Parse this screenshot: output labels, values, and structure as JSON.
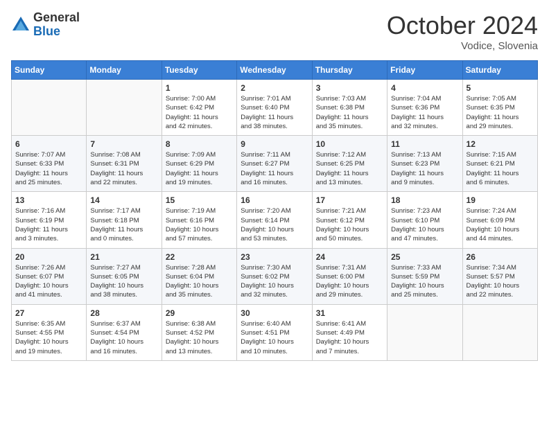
{
  "logo": {
    "line1": "General",
    "line2": "Blue"
  },
  "title": "October 2024",
  "subtitle": "Vodice, Slovenia",
  "weekdays": [
    "Sunday",
    "Monday",
    "Tuesday",
    "Wednesday",
    "Thursday",
    "Friday",
    "Saturday"
  ],
  "weeks": [
    [
      {
        "day": "",
        "content": ""
      },
      {
        "day": "",
        "content": ""
      },
      {
        "day": "1",
        "content": "Sunrise: 7:00 AM\nSunset: 6:42 PM\nDaylight: 11 hours\nand 42 minutes."
      },
      {
        "day": "2",
        "content": "Sunrise: 7:01 AM\nSunset: 6:40 PM\nDaylight: 11 hours\nand 38 minutes."
      },
      {
        "day": "3",
        "content": "Sunrise: 7:03 AM\nSunset: 6:38 PM\nDaylight: 11 hours\nand 35 minutes."
      },
      {
        "day": "4",
        "content": "Sunrise: 7:04 AM\nSunset: 6:36 PM\nDaylight: 11 hours\nand 32 minutes."
      },
      {
        "day": "5",
        "content": "Sunrise: 7:05 AM\nSunset: 6:35 PM\nDaylight: 11 hours\nand 29 minutes."
      }
    ],
    [
      {
        "day": "6",
        "content": "Sunrise: 7:07 AM\nSunset: 6:33 PM\nDaylight: 11 hours\nand 25 minutes."
      },
      {
        "day": "7",
        "content": "Sunrise: 7:08 AM\nSunset: 6:31 PM\nDaylight: 11 hours\nand 22 minutes."
      },
      {
        "day": "8",
        "content": "Sunrise: 7:09 AM\nSunset: 6:29 PM\nDaylight: 11 hours\nand 19 minutes."
      },
      {
        "day": "9",
        "content": "Sunrise: 7:11 AM\nSunset: 6:27 PM\nDaylight: 11 hours\nand 16 minutes."
      },
      {
        "day": "10",
        "content": "Sunrise: 7:12 AM\nSunset: 6:25 PM\nDaylight: 11 hours\nand 13 minutes."
      },
      {
        "day": "11",
        "content": "Sunrise: 7:13 AM\nSunset: 6:23 PM\nDaylight: 11 hours\nand 9 minutes."
      },
      {
        "day": "12",
        "content": "Sunrise: 7:15 AM\nSunset: 6:21 PM\nDaylight: 11 hours\nand 6 minutes."
      }
    ],
    [
      {
        "day": "13",
        "content": "Sunrise: 7:16 AM\nSunset: 6:19 PM\nDaylight: 11 hours\nand 3 minutes."
      },
      {
        "day": "14",
        "content": "Sunrise: 7:17 AM\nSunset: 6:18 PM\nDaylight: 11 hours\nand 0 minutes."
      },
      {
        "day": "15",
        "content": "Sunrise: 7:19 AM\nSunset: 6:16 PM\nDaylight: 10 hours\nand 57 minutes."
      },
      {
        "day": "16",
        "content": "Sunrise: 7:20 AM\nSunset: 6:14 PM\nDaylight: 10 hours\nand 53 minutes."
      },
      {
        "day": "17",
        "content": "Sunrise: 7:21 AM\nSunset: 6:12 PM\nDaylight: 10 hours\nand 50 minutes."
      },
      {
        "day": "18",
        "content": "Sunrise: 7:23 AM\nSunset: 6:10 PM\nDaylight: 10 hours\nand 47 minutes."
      },
      {
        "day": "19",
        "content": "Sunrise: 7:24 AM\nSunset: 6:09 PM\nDaylight: 10 hours\nand 44 minutes."
      }
    ],
    [
      {
        "day": "20",
        "content": "Sunrise: 7:26 AM\nSunset: 6:07 PM\nDaylight: 10 hours\nand 41 minutes."
      },
      {
        "day": "21",
        "content": "Sunrise: 7:27 AM\nSunset: 6:05 PM\nDaylight: 10 hours\nand 38 minutes."
      },
      {
        "day": "22",
        "content": "Sunrise: 7:28 AM\nSunset: 6:04 PM\nDaylight: 10 hours\nand 35 minutes."
      },
      {
        "day": "23",
        "content": "Sunrise: 7:30 AM\nSunset: 6:02 PM\nDaylight: 10 hours\nand 32 minutes."
      },
      {
        "day": "24",
        "content": "Sunrise: 7:31 AM\nSunset: 6:00 PM\nDaylight: 10 hours\nand 29 minutes."
      },
      {
        "day": "25",
        "content": "Sunrise: 7:33 AM\nSunset: 5:59 PM\nDaylight: 10 hours\nand 25 minutes."
      },
      {
        "day": "26",
        "content": "Sunrise: 7:34 AM\nSunset: 5:57 PM\nDaylight: 10 hours\nand 22 minutes."
      }
    ],
    [
      {
        "day": "27",
        "content": "Sunrise: 6:35 AM\nSunset: 4:55 PM\nDaylight: 10 hours\nand 19 minutes."
      },
      {
        "day": "28",
        "content": "Sunrise: 6:37 AM\nSunset: 4:54 PM\nDaylight: 10 hours\nand 16 minutes."
      },
      {
        "day": "29",
        "content": "Sunrise: 6:38 AM\nSunset: 4:52 PM\nDaylight: 10 hours\nand 13 minutes."
      },
      {
        "day": "30",
        "content": "Sunrise: 6:40 AM\nSunset: 4:51 PM\nDaylight: 10 hours\nand 10 minutes."
      },
      {
        "day": "31",
        "content": "Sunrise: 6:41 AM\nSunset: 4:49 PM\nDaylight: 10 hours\nand 7 minutes."
      },
      {
        "day": "",
        "content": ""
      },
      {
        "day": "",
        "content": ""
      }
    ]
  ]
}
